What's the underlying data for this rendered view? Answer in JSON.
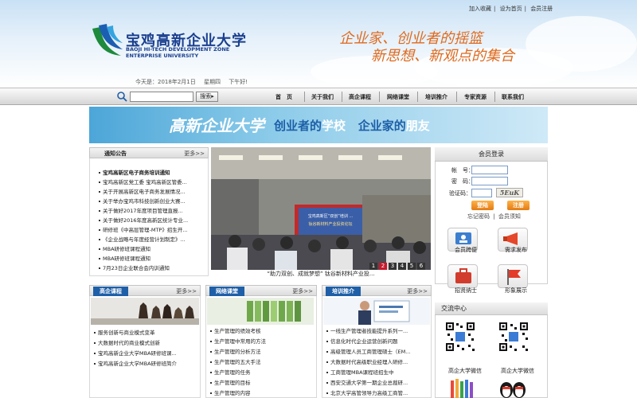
{
  "header": {
    "logo_cn": "宝鸡高新企业大学",
    "logo_en_line1": "BAOJI HI-TECH DEVELOPMENT ZONE",
    "logo_en_line2": "ENTERPRISE UNIVERSITY",
    "slogan_line1": "企业家、创业者的摇篮",
    "slogan_line2": "新思想、新观点的集合",
    "top_links": [
      "加入收藏",
      "设为首页",
      "会员注册"
    ],
    "date_prefix": "今天是：2018年2月1日",
    "weekday": "星期四",
    "greeting": "下午好!"
  },
  "nav": {
    "search_placeholder": "",
    "search_button": "搜索",
    "items": [
      "首　页",
      "关于我们",
      "高企课程",
      "网络课堂",
      "培训推介",
      "专家资源",
      "联系我们"
    ]
  },
  "banner": {
    "title": "高新企业大学",
    "tagline_a": "创业者的",
    "tagline_b": "学校",
    "tagline_c": "企业家的",
    "tagline_d": "朋友"
  },
  "news": {
    "title": "通知公告",
    "more": "更多>>",
    "items": [
      "宝鸡高新区电子商务培训通知",
      "宝鸡高新区党工委 宝鸡高新区管委...",
      "关于开展高新区电子商务发展情况...",
      "关于举办宝鸡市科技创新创业大赛...",
      "关于做好2017年度项目管理直报...",
      "关于做好2016年度高新区统计专业...",
      "研修班《中高层管理-MTP》招生开...",
      "《企业战略与年度经营计划制定》...",
      "MBA研修班课程通知",
      "MBA研修班课程通知",
      "7月23日企业联合会内训通知"
    ]
  },
  "slideshow": {
    "caption": "“助力双创、成就梦想” 钛谷新材料产业投...",
    "pages": [
      "1",
      "2",
      "3",
      "4",
      "5",
      "6"
    ],
    "active_page": "2",
    "screen_text_1": "宝鸡高新区“双创”培训 ...",
    "screen_text_2": "钛谷新材料产业投资论坛"
  },
  "login": {
    "title": "会员登录",
    "account_label": "帐　号：",
    "password_label": "密　码：",
    "captcha_label": "验证码：",
    "captcha_text": "5EuK",
    "login_button": "登陆",
    "register_button": "注册",
    "forgot": "忘记密码",
    "notice": "会员须知",
    "quick": [
      "会员跨便",
      "需求发布",
      "招贤纳士",
      "形象展示"
    ]
  },
  "courses": {
    "title": "高企课程",
    "more": "更多>>",
    "items": [
      "服务创新与商业模式变革",
      "大数据时代的商业模式创新",
      "宝鸡高新企业大学MBA研修班课...",
      "宝鸡高新企业大学MBA研修班简介"
    ]
  },
  "online": {
    "title": "网络课堂",
    "more": "更多>>",
    "items": [
      "生产管理的绩效考核",
      "生产管理中常用的方法",
      "生产管理的分析方法",
      "生产管理的五大手法",
      "生产管理的任务",
      "生产管理的目标",
      "生产管理的内容"
    ]
  },
  "training": {
    "title": "培训推介",
    "more": "更多>>",
    "items": [
      "一线生产管理者技能提升系列一...",
      "信息化时代企业运营创新问题",
      "高级管理人员工商管理硕士（EM...",
      "大数据时代高级职业经理人研修...",
      "工商管理MBA课程班招生中",
      "西安交通大学第一期企业总裁研...",
      "北京大学高管领导力高级工商管..."
    ]
  },
  "exchange": {
    "title": "交流中心",
    "qr_labels": [
      "高企大学微信",
      "高企大学微信"
    ]
  }
}
